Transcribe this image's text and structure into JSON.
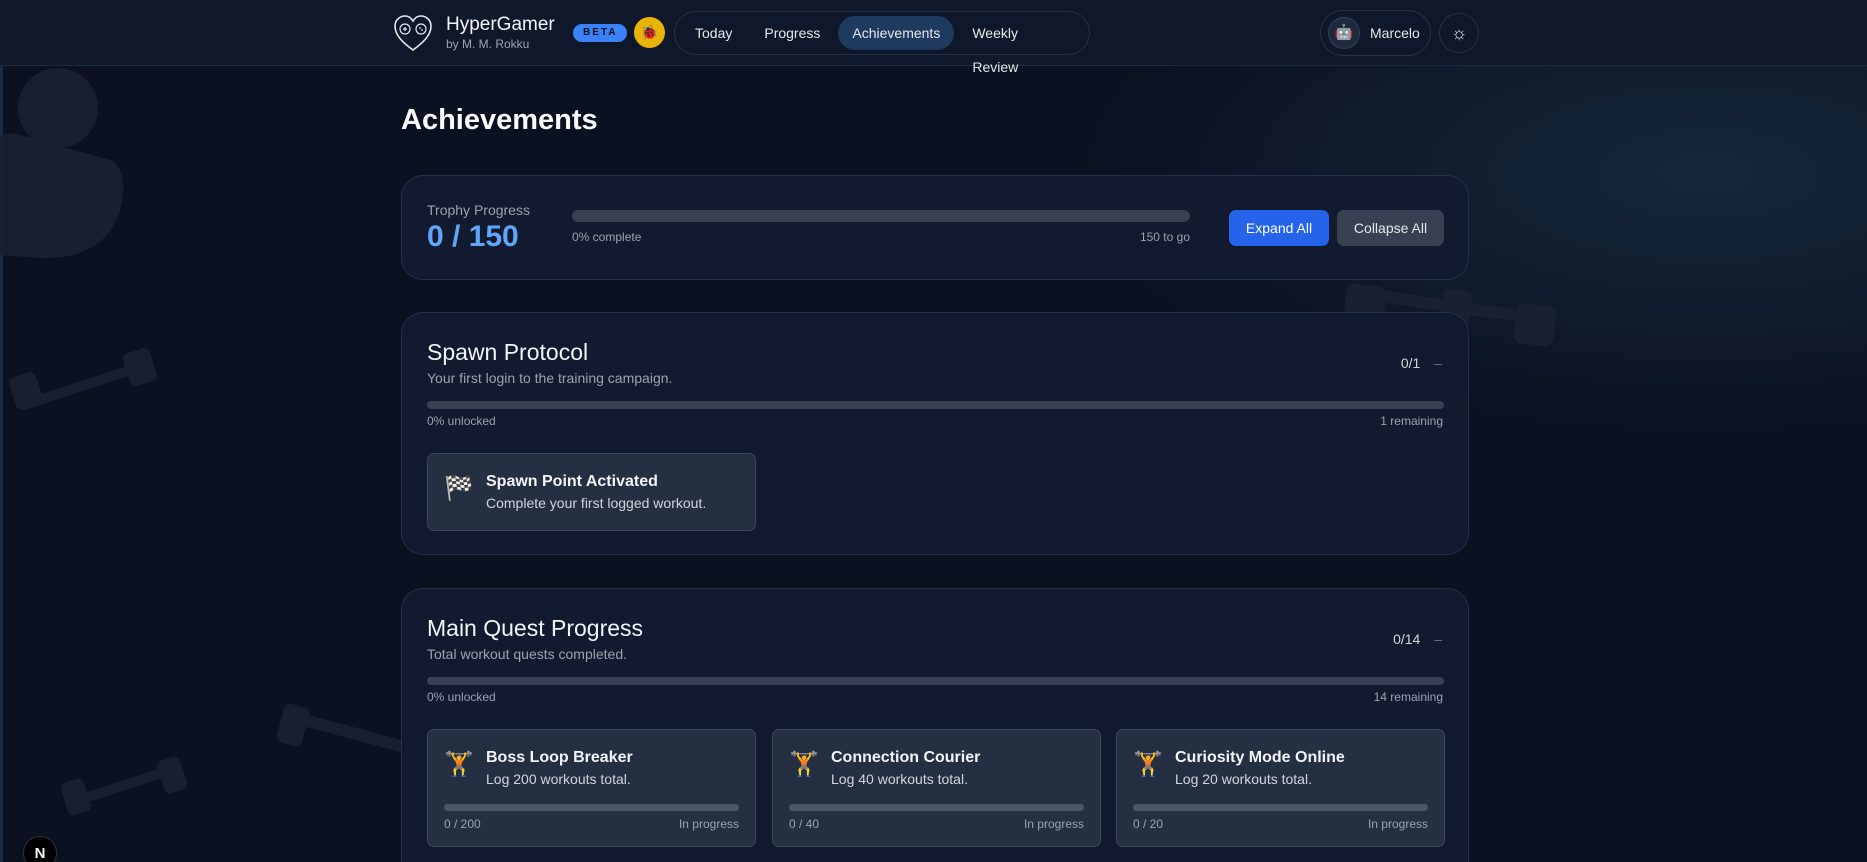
{
  "app": {
    "title": "HyperGamer",
    "subtitle": "by M. M. Rokku",
    "badge": "BETA",
    "coin_icon": "coin-icon"
  },
  "nav": {
    "tabs": [
      {
        "label": "Today",
        "active": false
      },
      {
        "label": "Progress",
        "active": false
      },
      {
        "label": "Achievements",
        "active": true
      },
      {
        "label": "Weekly Review",
        "active": false
      }
    ]
  },
  "user": {
    "name": "Marcelo",
    "avatar_icon": "robot-icon"
  },
  "theme_toggle_icon": "sun-icon",
  "page": {
    "title": "Achievements"
  },
  "trophy": {
    "label": "Trophy Progress",
    "value": "0 / 150",
    "percent_text": "0% complete",
    "to_go": "150 to go",
    "progress": 0
  },
  "actions": {
    "expand_all": "Expand All",
    "collapse_all": "Collapse All"
  },
  "sections": [
    {
      "title": "Spawn Protocol",
      "description": "Your first login to the training campaign.",
      "count": "0/1",
      "toggle": "–",
      "percent_text": "0% unlocked",
      "remaining": "1 remaining",
      "progress": 0,
      "achievements": [
        {
          "icon": "checkered-flag-icon",
          "glyph": "🏁",
          "title": "Spawn Point Activated",
          "description": "Complete your first logged workout."
        }
      ]
    },
    {
      "title": "Main Quest Progress",
      "description": "Total workout quests completed.",
      "count": "0/14",
      "toggle": "–",
      "percent_text": "0% unlocked",
      "remaining": "14 remaining",
      "progress": 0,
      "achievements": [
        {
          "icon": "weightlifter-icon",
          "glyph": "🏋",
          "title": "Boss Loop Breaker",
          "description": "Log 200 workouts total.",
          "progress_text": "0 / 200",
          "status": "In progress",
          "progress": 0
        },
        {
          "icon": "weightlifter-icon",
          "glyph": "🏋",
          "title": "Connection Courier",
          "description": "Log 40 workouts total.",
          "progress_text": "0 / 40",
          "status": "In progress",
          "progress": 0
        },
        {
          "icon": "weightlifter-icon",
          "glyph": "🏋",
          "title": "Curiosity Mode Online",
          "description": "Log 20 workouts total.",
          "progress_text": "0 / 20",
          "status": "In progress",
          "progress": 0
        }
      ]
    }
  ],
  "devtools_badge": "N",
  "colors": {
    "background": "#0b1120",
    "accent": "#3b82f6",
    "accent_text": "#60a5fa",
    "card": "#111a2e",
    "coin": "#eab308"
  }
}
